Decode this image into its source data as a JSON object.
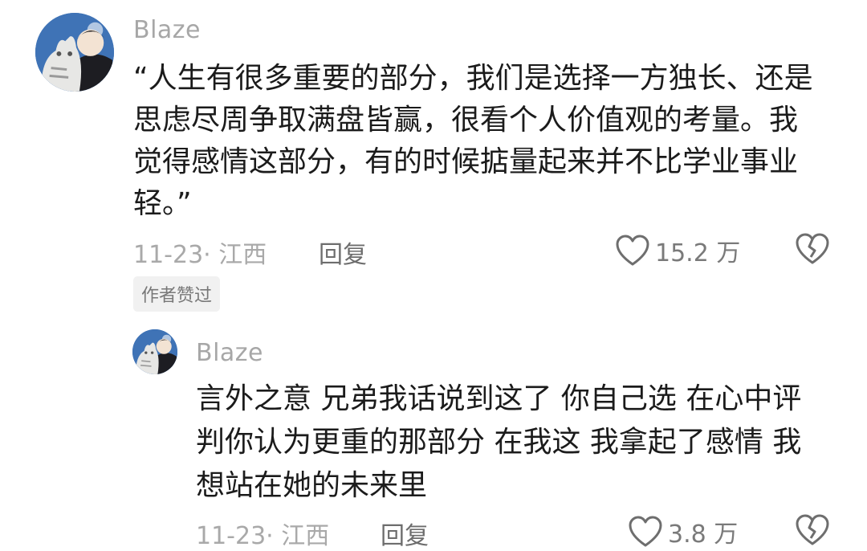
{
  "comment": {
    "username": "Blaze",
    "text": "“人生有很多重要的部分，我们是选择一方独长、还是思虑尽周争取满盘皆赢，很看个人价值观的考量。我觉得感情这部分，有的时候掂量起来并不比学业事业轻。”",
    "date_location": "11-23· 江西",
    "reply_label": "回复",
    "like_count": "15.2 万",
    "badge": "作者赞过"
  },
  "reply": {
    "username": "Blaze",
    "text": "言外之意 兄弟我话说到这了 你自己选 在心中评判你认为更重的那部分 在我这 我拿起了感情 我想站在她的未来里",
    "date_location": "11-23· 江西",
    "reply_label": "回复",
    "like_count": "3.8 万"
  },
  "icons": {
    "like": "heart-outline-icon",
    "dislike": "broken-heart-icon"
  },
  "colors": {
    "text": "#1b1b1b",
    "muted": "#a9a9a9",
    "badge_bg": "#f1f1f1"
  }
}
